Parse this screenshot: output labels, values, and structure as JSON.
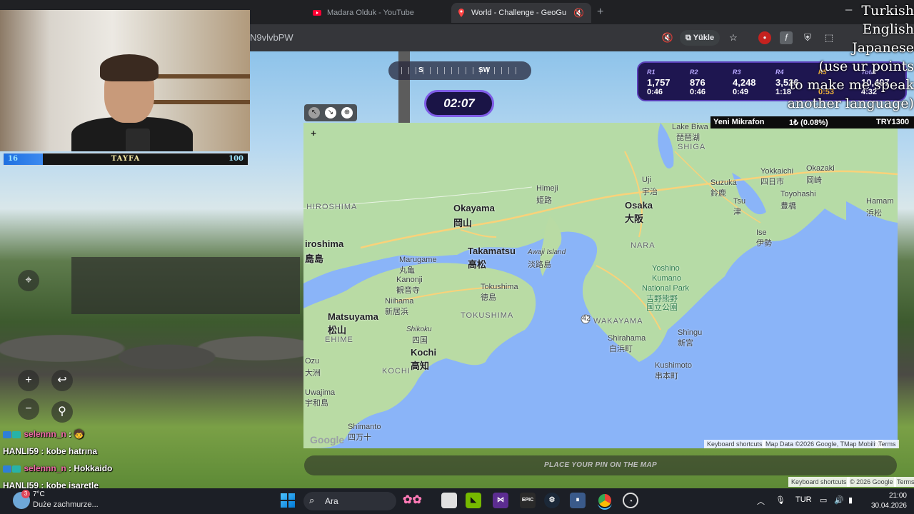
{
  "browser": {
    "tabs": [
      {
        "title": "Madara Olduk - YouTube",
        "active": false
      },
      {
        "title": "World - Challenge - GeoGu",
        "active": true
      }
    ],
    "url_fragment": "N9vlvbPW",
    "upload_label": "Yükle",
    "new_tab_glyph": "+"
  },
  "stream": {
    "bar_left": "16",
    "bar_title": "TAYFA",
    "bar_right": "100",
    "bar_progress": 0.16,
    "languages": [
      "Turkish",
      "English",
      "Japanese",
      "(use ur points",
      "to make me speak",
      "another language)"
    ],
    "ticker": {
      "name": "Yeni Mikrafon",
      "amount": "1₺ (0.08%)",
      "goal": "TRY1300"
    }
  },
  "game": {
    "compass": {
      "left": "S",
      "right": "SW"
    },
    "timer": "02:07",
    "rounds": [
      {
        "label": "R1",
        "points": "1,757",
        "time": "0:46",
        "highlight": false
      },
      {
        "label": "R2",
        "points": "876",
        "time": "0:46",
        "highlight": false
      },
      {
        "label": "R3",
        "points": "4,248",
        "time": "0:49",
        "highlight": false
      },
      {
        "label": "R4",
        "points": "3,526",
        "time": "1:18",
        "highlight": false
      },
      {
        "label": "R5",
        "points": "",
        "time": "0:53",
        "highlight": true
      },
      {
        "label": "Total",
        "points": "10,407",
        "time": "4:32",
        "highlight": false
      }
    ],
    "place_pin": "PLACE YOUR PIN ON THE MAP"
  },
  "map": {
    "labels": [
      {
        "text": "Lake Biwa",
        "cls": ""
      },
      {
        "text": "琵琶湖",
        "cls": ""
      },
      {
        "text": "SHIGA",
        "cls": "reg"
      },
      {
        "text": "HIROSHIMA",
        "cls": "reg"
      },
      {
        "text": "Okayama",
        "cls": "big"
      },
      {
        "text": "岡山",
        "cls": "big"
      },
      {
        "text": "Himeji",
        "cls": ""
      },
      {
        "text": "姫路",
        "cls": ""
      },
      {
        "text": "Uji",
        "cls": ""
      },
      {
        "text": "宇治",
        "cls": ""
      },
      {
        "text": "Osaka",
        "cls": "big"
      },
      {
        "text": "大阪",
        "cls": "big"
      },
      {
        "text": "Suzuka",
        "cls": ""
      },
      {
        "text": "鈴鹿",
        "cls": ""
      },
      {
        "text": "Yokkaichi",
        "cls": ""
      },
      {
        "text": "四日市",
        "cls": ""
      },
      {
        "text": "Okazaki",
        "cls": ""
      },
      {
        "text": "岡崎",
        "cls": ""
      },
      {
        "text": "Toyohashi",
        "cls": ""
      },
      {
        "text": "豊橋",
        "cls": ""
      },
      {
        "text": "Hamam",
        "cls": ""
      },
      {
        "text": "浜松",
        "cls": ""
      },
      {
        "text": "Tsu",
        "cls": ""
      },
      {
        "text": "津",
        "cls": ""
      },
      {
        "text": "Ise",
        "cls": ""
      },
      {
        "text": "伊勢",
        "cls": ""
      },
      {
        "text": "iroshima",
        "cls": "big"
      },
      {
        "text": "広島",
        "cls": "big"
      },
      {
        "text": "Marugame",
        "cls": ""
      },
      {
        "text": "丸亀",
        "cls": ""
      },
      {
        "text": "Takamatsu",
        "cls": "big"
      },
      {
        "text": "高松",
        "cls": "big"
      },
      {
        "text": "Awaji Island",
        "cls": "isl"
      },
      {
        "text": "淡路島",
        "cls": ""
      },
      {
        "text": "NARA",
        "cls": "reg"
      },
      {
        "text": "Kanonji",
        "cls": ""
      },
      {
        "text": "観音寺",
        "cls": ""
      },
      {
        "text": "Tokushima",
        "cls": ""
      },
      {
        "text": "徳島",
        "cls": ""
      },
      {
        "text": "Yoshino",
        "cls": "park"
      },
      {
        "text": "Kumano",
        "cls": "park"
      },
      {
        "text": "National Park",
        "cls": "park"
      },
      {
        "text": "吉野熊野",
        "cls": "park"
      },
      {
        "text": "国立公園",
        "cls": "park"
      },
      {
        "text": "Niihama",
        "cls": ""
      },
      {
        "text": "新居浜",
        "cls": ""
      },
      {
        "text": "Matsuyama",
        "cls": "big"
      },
      {
        "text": "松山",
        "cls": "big"
      },
      {
        "text": "TOKUSHIMA",
        "cls": "reg"
      },
      {
        "text": "WAKAYAMA",
        "cls": "reg"
      },
      {
        "text": "EHIME",
        "cls": "reg"
      },
      {
        "text": "Shikoku",
        "cls": "isl"
      },
      {
        "text": "四国",
        "cls": ""
      },
      {
        "text": "Shingu",
        "cls": ""
      },
      {
        "text": "新宮",
        "cls": ""
      },
      {
        "text": "Shirahama",
        "cls": ""
      },
      {
        "text": "白浜町",
        "cls": ""
      },
      {
        "text": "Kochi",
        "cls": "big"
      },
      {
        "text": "高知",
        "cls": "big"
      },
      {
        "text": "KOCHI",
        "cls": "reg"
      },
      {
        "text": "Ozu",
        "cls": ""
      },
      {
        "text": "大洲",
        "cls": ""
      },
      {
        "text": "Kushimoto",
        "cls": ""
      },
      {
        "text": "串本町",
        "cls": ""
      },
      {
        "text": "Uwajima",
        "cls": ""
      },
      {
        "text": "宇和島",
        "cls": ""
      },
      {
        "text": "Shimanto",
        "cls": ""
      },
      {
        "text": "四万十",
        "cls": ""
      },
      {
        "text": "島",
        "cls": "big"
      },
      {
        "text": "42",
        "cls": ""
      }
    ],
    "footer": {
      "shortcuts": "Keyboard shortcuts",
      "data": "Map Data ©2026 Google, TMap Mobility",
      "terms": "Terms"
    },
    "google": "Google"
  },
  "street_footer": {
    "shortcuts": "Keyboard shortcuts",
    "copyright": "© 2026 Google",
    "terms": "Terms"
  },
  "chat": [
    {
      "user": "selennn_n",
      "msg": "",
      "color": "pink"
    },
    {
      "user": "HANLI59",
      "msg": "kobe hatrına",
      "color": "white"
    },
    {
      "user": "selennn_n",
      "msg": "Hokkaido",
      "color": "pink"
    },
    {
      "user": "HANLI59",
      "msg": "kobe işaretle",
      "color": "white"
    }
  ],
  "taskbar": {
    "weather_temp": "7°C",
    "weather_desc": "Duże zachmurze...",
    "weather_badge": "3",
    "search": "Ara",
    "lang": "TUR",
    "time": "21:00",
    "date": "30.04.2026"
  }
}
